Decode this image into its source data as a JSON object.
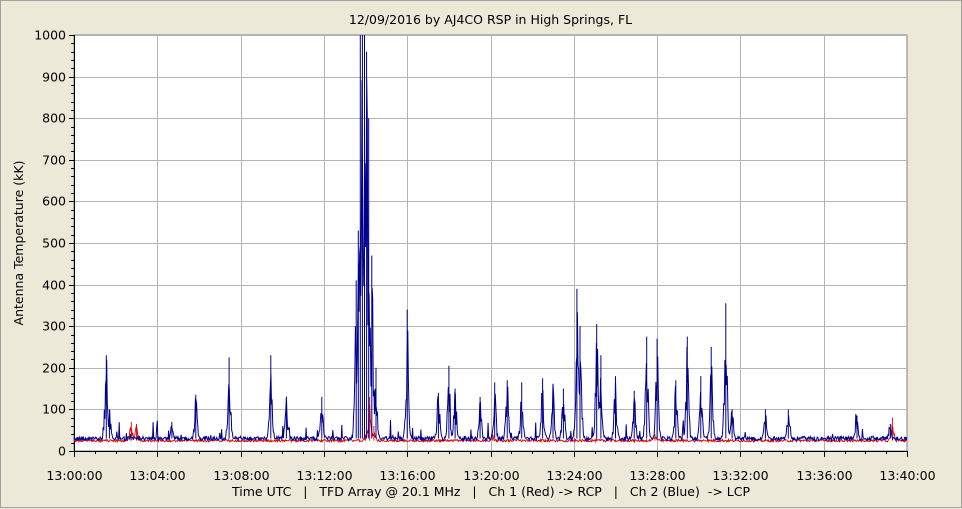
{
  "chart_data": {
    "type": "line",
    "title": "12/09/2016  by  AJ4CO RSP  in  High Springs, FL",
    "ylabel": "Antenna Temperature (kK)",
    "xlabel": "Time UTC   |   TFD Array @ 20.1 MHz   |   Ch 1 (Red) -> RCP   |   Ch 2 (Blue)  -> LCP",
    "ylim": [
      0,
      1000
    ],
    "y_ticks": [
      "0",
      "100",
      "200",
      "300",
      "400",
      "500",
      "600",
      "700",
      "800",
      "900",
      "1000"
    ],
    "x_ticks": [
      "13:00:00",
      "13:04:00",
      "13:08:00",
      "13:12:00",
      "13:16:00",
      "13:20:00",
      "13:24:00",
      "13:28:00",
      "13:32:00",
      "13:36:00",
      "13:40:00"
    ],
    "xlim_minutes": [
      0,
      40
    ],
    "grid": true,
    "series": [
      {
        "channel": "Ch 1 (Red) -> RCP",
        "color": "#e00000",
        "baseline": 25,
        "peaks": [
          {
            "t": 2.75,
            "v": 70
          },
          {
            "t": 3.0,
            "v": 65
          },
          {
            "t": 14.0,
            "v": 40
          },
          {
            "t": 14.2,
            "v": 130
          },
          {
            "t": 14.4,
            "v": 60
          },
          {
            "t": 20.1,
            "v": 40
          },
          {
            "t": 27.9,
            "v": 40
          },
          {
            "t": 39.3,
            "v": 80
          }
        ]
      },
      {
        "channel": "Ch 2 (Blue)  -> LCP",
        "color": "#00008b",
        "baseline": 30,
        "peaks": [
          {
            "t": 1.55,
            "v": 230
          },
          {
            "t": 1.7,
            "v": 100
          },
          {
            "t": 4.7,
            "v": 70
          },
          {
            "t": 5.85,
            "v": 135
          },
          {
            "t": 7.45,
            "v": 225
          },
          {
            "t": 9.45,
            "v": 230
          },
          {
            "t": 10.2,
            "v": 130
          },
          {
            "t": 11.9,
            "v": 130
          },
          {
            "t": 13.55,
            "v": 410
          },
          {
            "t": 13.65,
            "v": 530
          },
          {
            "t": 13.75,
            "v": 1000
          },
          {
            "t": 13.85,
            "v": 1000
          },
          {
            "t": 13.95,
            "v": 1000
          },
          {
            "t": 14.05,
            "v": 960
          },
          {
            "t": 14.15,
            "v": 800
          },
          {
            "t": 14.3,
            "v": 470
          },
          {
            "t": 14.5,
            "v": 200
          },
          {
            "t": 16.0,
            "v": 340
          },
          {
            "t": 17.5,
            "v": 140
          },
          {
            "t": 18.0,
            "v": 205
          },
          {
            "t": 18.3,
            "v": 150
          },
          {
            "t": 19.5,
            "v": 130
          },
          {
            "t": 20.2,
            "v": 165
          },
          {
            "t": 20.8,
            "v": 170
          },
          {
            "t": 21.5,
            "v": 165
          },
          {
            "t": 22.5,
            "v": 175
          },
          {
            "t": 23.0,
            "v": 160
          },
          {
            "t": 23.5,
            "v": 150
          },
          {
            "t": 24.15,
            "v": 390
          },
          {
            "t": 24.3,
            "v": 300
          },
          {
            "t": 25.1,
            "v": 305
          },
          {
            "t": 25.3,
            "v": 230
          },
          {
            "t": 26.0,
            "v": 180
          },
          {
            "t": 26.9,
            "v": 145
          },
          {
            "t": 27.5,
            "v": 275
          },
          {
            "t": 28.0,
            "v": 270
          },
          {
            "t": 28.9,
            "v": 170
          },
          {
            "t": 29.45,
            "v": 275
          },
          {
            "t": 30.1,
            "v": 180
          },
          {
            "t": 30.6,
            "v": 250
          },
          {
            "t": 31.3,
            "v": 355
          },
          {
            "t": 31.6,
            "v": 100
          },
          {
            "t": 33.2,
            "v": 100
          },
          {
            "t": 34.3,
            "v": 100
          },
          {
            "t": 37.6,
            "v": 85
          },
          {
            "t": 39.2,
            "v": 65
          }
        ]
      }
    ]
  }
}
